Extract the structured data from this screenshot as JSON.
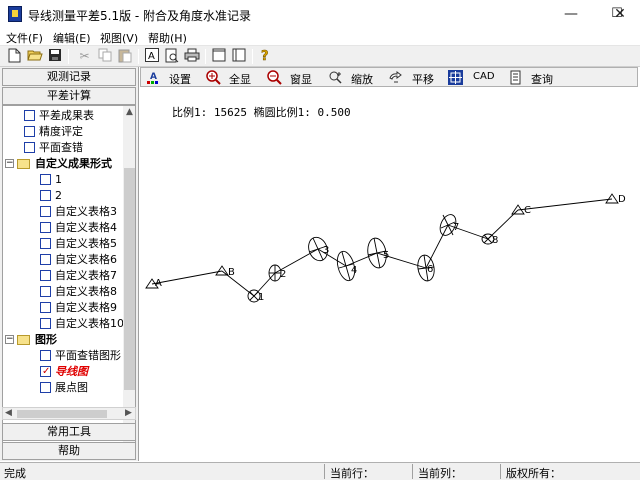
{
  "window": {
    "title": "导线测量平差5.1版 - 附合及角度水准记录",
    "minimize_glyph": "—",
    "maximize_glyph": "☐",
    "close_glyph": "✕"
  },
  "menu": [
    "文件(F)",
    "编辑(E)",
    "视图(V)",
    "帮助(H)"
  ],
  "toolbar_icons": [
    "new-file-icon",
    "open-folder-icon",
    "save-icon",
    "cut-icon",
    "copy-icon",
    "paste-icon",
    "text-icon",
    "print-preview-icon",
    "print-icon",
    "single-panel-icon",
    "double-panel-icon",
    "help-icon"
  ],
  "left_panel": {
    "top_buttons": [
      "观测记录",
      "平差计算"
    ],
    "bottom_buttons": [
      "常用工具",
      "帮助"
    ],
    "tree": [
      {
        "label": "平差成果表",
        "checked": false
      },
      {
        "label": "精度评定",
        "checked": false
      },
      {
        "label": "平面查错",
        "checked": false
      },
      {
        "label": "自定义成果形式",
        "folder": true
      },
      {
        "label": "1",
        "checked": false
      },
      {
        "label": "2",
        "checked": false
      },
      {
        "label": "自定义表格3",
        "checked": false
      },
      {
        "label": "自定义表格4",
        "checked": false
      },
      {
        "label": "自定义表格5",
        "checked": false
      },
      {
        "label": "自定义表格6",
        "checked": false
      },
      {
        "label": "自定义表格7",
        "checked": false
      },
      {
        "label": "自定义表格8",
        "checked": false
      },
      {
        "label": "自定义表格9",
        "checked": false
      },
      {
        "label": "自定义表格10",
        "checked": false
      },
      {
        "label": "图形",
        "folder": true
      },
      {
        "label": "平面查错图形",
        "checked": false
      },
      {
        "label": "导线图",
        "checked": true
      },
      {
        "label": "展点图",
        "checked": false
      }
    ],
    "active_color": "#e00000"
  },
  "graphic_toolbar": [
    {
      "label": "设置",
      "icon": "settings-icon"
    },
    {
      "label": "全显",
      "icon": "zoom-all-icon"
    },
    {
      "label": "窗显",
      "icon": "zoom-window-icon"
    },
    {
      "label": "缩放",
      "icon": "zoom-icon"
    },
    {
      "label": "平移",
      "icon": "pan-icon"
    },
    {
      "label": "CAD",
      "icon": "cad-icon"
    },
    {
      "label": "查询",
      "icon": "query-icon"
    }
  ],
  "canvas": {
    "scale_text": "比例1: 15625  椭圆比例1: 0.500",
    "points": [
      {
        "name": "A",
        "type": "known"
      },
      {
        "name": "B",
        "type": "known"
      },
      {
        "name": "1",
        "type": "unknown"
      },
      {
        "name": "2",
        "type": "unknown"
      },
      {
        "name": "3",
        "type": "unknown"
      },
      {
        "name": "4",
        "type": "unknown"
      },
      {
        "name": "5",
        "type": "unknown"
      },
      {
        "name": "6",
        "type": "unknown"
      },
      {
        "name": "7",
        "type": "unknown"
      },
      {
        "name": "8",
        "type": "unknown"
      },
      {
        "name": "C",
        "type": "known"
      },
      {
        "name": "D",
        "type": "known"
      }
    ]
  },
  "status": {
    "state": "完成",
    "current_row_label": "当前行：",
    "current_col_label": "当前列：",
    "copyright_label": "版权所有："
  }
}
